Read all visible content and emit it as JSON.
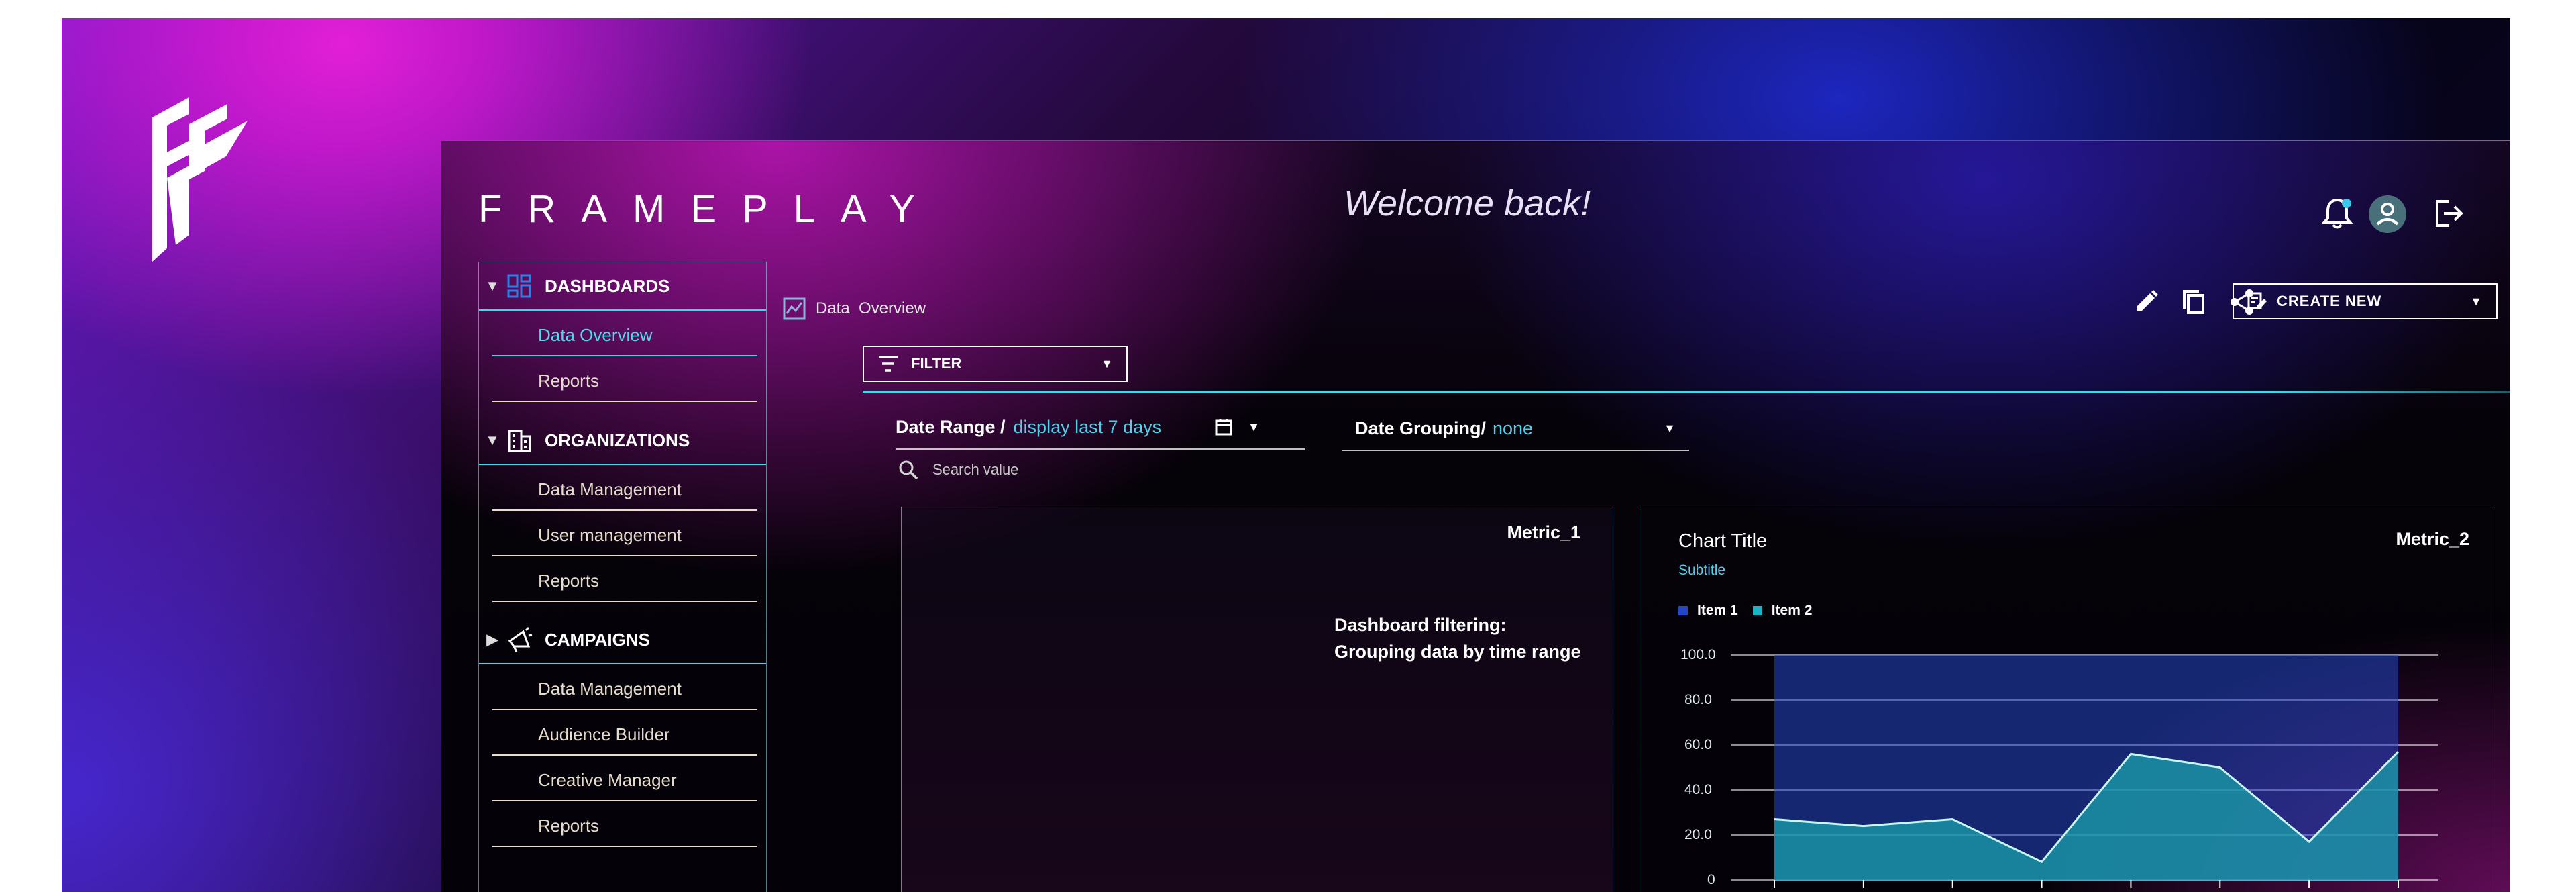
{
  "app": {
    "brand": "FRAMEPLAY",
    "welcome": "Welcome back!"
  },
  "toolbar": {
    "create_new_label": "CREATE NEW",
    "filter_label": "FILTER"
  },
  "breadcrumb": {
    "current": "Data  Overview"
  },
  "filters": {
    "date_range_label": "Date Range /",
    "date_range_value": "display last 7 days",
    "date_grouping_label": "Date Grouping/",
    "date_grouping_value": "none",
    "search_placeholder": "Search value"
  },
  "sidebar": {
    "sections": [
      {
        "label": "DASHBOARDS",
        "expanded": true,
        "items": [
          "Data Overview",
          "Reports"
        ]
      },
      {
        "label": "ORGANIZATIONS",
        "expanded": true,
        "items": [
          "Data Management",
          "User management",
          "Reports"
        ]
      },
      {
        "label": "CAMPAIGNS",
        "expanded": false,
        "items": [
          "Data Management",
          "Audience Builder",
          "Creative Manager",
          "Reports"
        ]
      }
    ],
    "active_item": "Data Overview"
  },
  "panels": {
    "metric1": {
      "title": "Metric_1",
      "note_line1": "Dashboard filtering:",
      "note_line2": "Grouping data by time range"
    },
    "metric2": {
      "metric_label": "Metric_2",
      "chart_title": "Chart Title",
      "chart_subtitle": "Subtitle"
    }
  },
  "colors": {
    "accent_cyan": "#40d8e6",
    "item1_blue": "#2447c8",
    "item2_teal": "#1ab5c4",
    "notification_dot": "#39c7ea"
  },
  "chart_data": {
    "type": "area",
    "title": "Chart Title",
    "subtitle": "Subtitle",
    "ylim": [
      0,
      100
    ],
    "yticks": [
      "100.0",
      "80.0",
      "60.0",
      "40.0",
      "20.0",
      "0"
    ],
    "grid": true,
    "legend": "top-left",
    "series": [
      {
        "name": "Item 1",
        "values": [
          100,
          100,
          100,
          100,
          100,
          100,
          100,
          100
        ]
      },
      {
        "name": "Item 2",
        "values": [
          27,
          24,
          27,
          8,
          56,
          50,
          17,
          57
        ]
      }
    ]
  }
}
